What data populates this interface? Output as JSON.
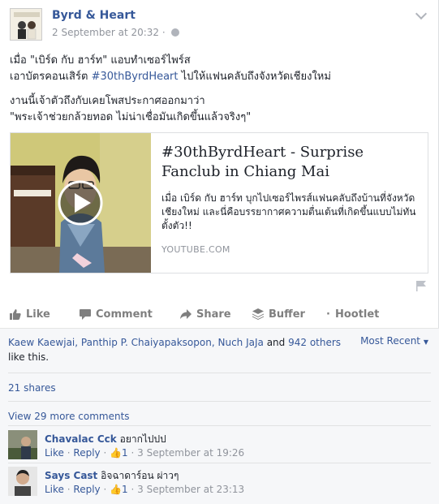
{
  "post": {
    "page_name": "Byrd & Heart",
    "timestamp": "2 September at 20:32",
    "separator": " · ",
    "text": {
      "line1": "เมื่อ \"เบิร์ด กับ ฮาร์ท\" แอบทำเซอร์ไพร์ส",
      "line2_before": "เอาบัตรคอนเสิร์ต ",
      "hashtag": "#30thByrdHeart",
      "line2_after": " ไปให้แฟนคลับถึงจังหวัดเชียงใหม่",
      "line3": "งานนี้เจ้าตัวถึงกับเคยโพสประกาศออกมาว่า",
      "line4": "\"พระเจ้าช่วยกล้วยทอด ไม่น่าเชื่อมันเกิดขึ้นแล้วจริงๆ\""
    }
  },
  "link_preview": {
    "title": "#30thByrdHeart - Surprise Fanclub in Chiang Mai",
    "description": "เมื่อ เบิร์ด กับ ฮาร์ท บุกไปเซอร์ไพรส์แฟนคลับถึงบ้านที่จังหวัดเชียงใหม่ และนี่คือบรรยากาศความตื่นเต้นที่เกิดขึ้นแบบไม่ทันตั้งตัว!!",
    "domain": "YOUTUBE.COM"
  },
  "actions": {
    "like": "Like",
    "comment": "Comment",
    "share": "Share",
    "buffer": "Buffer",
    "hootlet": "Hootlet"
  },
  "reactions": {
    "liker1": "Kaew Kaewjai",
    "liker2": "Panthip P. Chaiyapaksopon",
    "liker3": "Nuch JaJa",
    "and": " and ",
    "others": "942 others",
    "like_this": "like this.",
    "sort": "Most Recent"
  },
  "shares": "21 shares",
  "view_more": "View 29 more comments",
  "comments": [
    {
      "author": "Chavalac Cck",
      "text": "อยากไปปป",
      "like": "Like",
      "reply": "Reply",
      "likes": "1",
      "time": "3 September at 19:26"
    },
    {
      "author": "Says Cast",
      "text": "อิจฉาดาร์อน ผ่าวๆ",
      "like": "Like",
      "reply": "Reply",
      "likes": "1",
      "time": "3 September at 23:13"
    }
  ],
  "colors": {
    "link": "#365899",
    "meta": "#90949c",
    "action": "#7f7f7f"
  }
}
